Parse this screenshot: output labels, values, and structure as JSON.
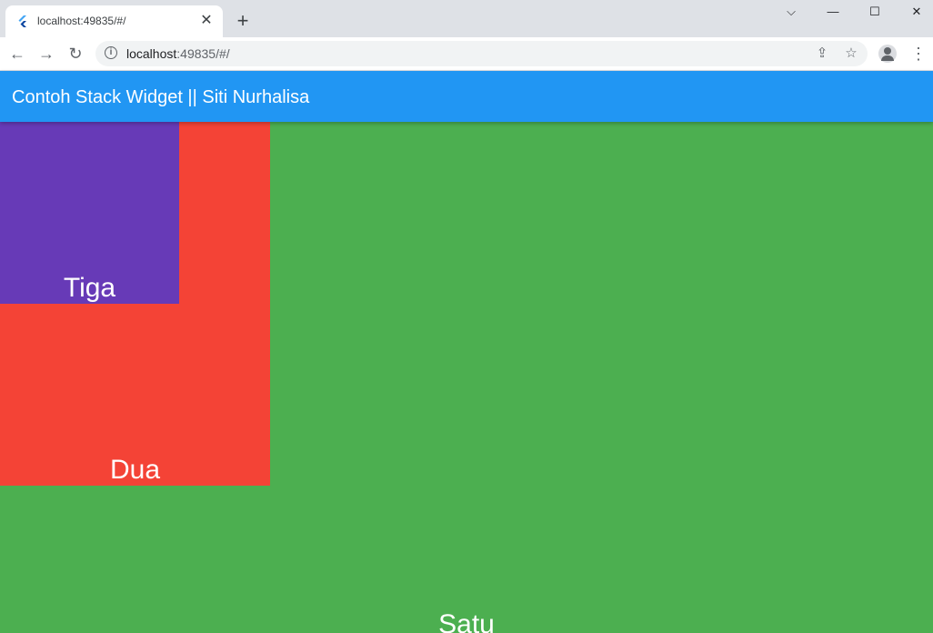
{
  "browser": {
    "tab_title": "localhost:49835/#/",
    "url_host": "localhost",
    "url_rest": ":49835/#/",
    "icons": {
      "favicon": "flutter-icon",
      "close": "close-icon",
      "new_tab": "plus-icon",
      "back": "back-arrow-icon",
      "forward": "forward-arrow-icon",
      "reload": "reload-icon",
      "info": "info-icon",
      "share": "share-icon",
      "bookmark": "star-icon",
      "profile": "profile-icon",
      "menu": "kebab-menu-icon"
    }
  },
  "app": {
    "title": "Contoh Stack Widget || Siti Nurhalisa",
    "appbar_color": "#2196f3",
    "boxes": [
      {
        "label": "Satu",
        "color": "#4caf50"
      },
      {
        "label": "Dua",
        "color": "#f44336"
      },
      {
        "label": "Tiga",
        "color": "#673ab7"
      }
    ]
  }
}
